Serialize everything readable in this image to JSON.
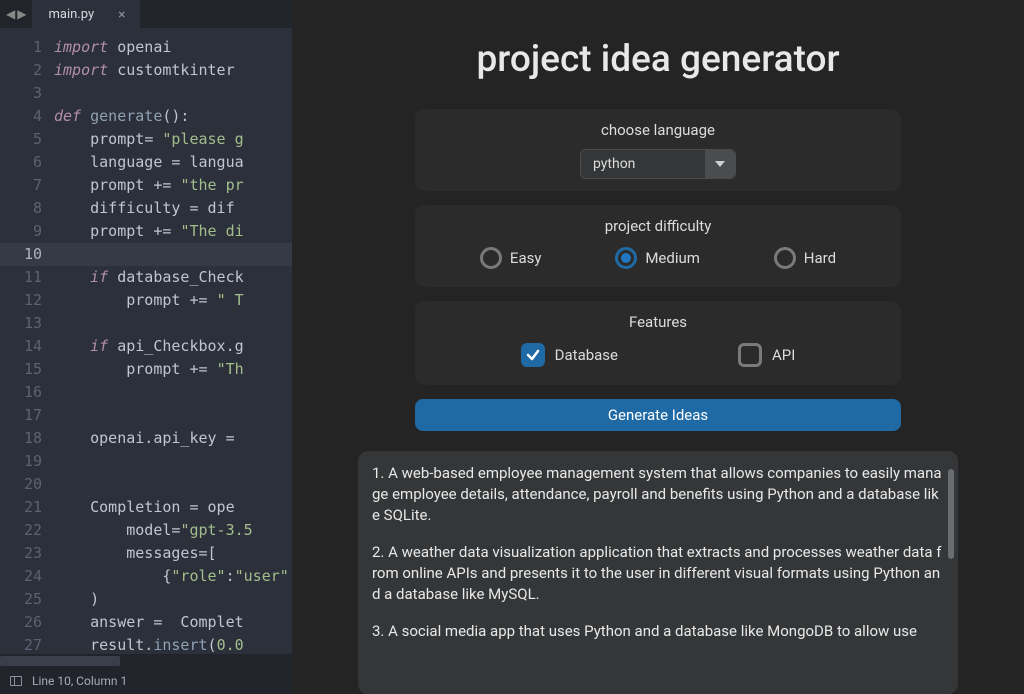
{
  "editor": {
    "tab_name": "main.py",
    "tab_close": "×",
    "nav_back": "◀",
    "nav_fwd": "▶",
    "status": "Line 10, Column 1",
    "current_line": 10,
    "lines": [
      {
        "n": 1,
        "html": "<span class='kw'>import</span> <span class='id'>openai</span>"
      },
      {
        "n": 2,
        "html": "<span class='kw'>import</span> <span class='id'>customtkinter</span>"
      },
      {
        "n": 3,
        "html": ""
      },
      {
        "n": 4,
        "html": "<span class='kw'>def</span> <span class='fn'>generate</span><span class='op'>():</span>"
      },
      {
        "n": 5,
        "html": "    prompt<span class='op'>=</span> <span class='st'>\"please g</span>"
      },
      {
        "n": 6,
        "html": "    language <span class='op'>=</span> langua"
      },
      {
        "n": 7,
        "html": "    prompt <span class='op'>+=</span> <span class='st'>\"the pr</span>"
      },
      {
        "n": 8,
        "html": "    difficulty <span class='op'>=</span> dif"
      },
      {
        "n": 9,
        "html": "    prompt <span class='op'>+=</span> <span class='st'>\"The di</span>"
      },
      {
        "n": 10,
        "html": ""
      },
      {
        "n": 11,
        "html": "    <span class='kw'>if</span> database_Check"
      },
      {
        "n": 12,
        "html": "        prompt <span class='op'>+=</span> <span class='st'>\" T</span>"
      },
      {
        "n": 13,
        "html": ""
      },
      {
        "n": 14,
        "html": "    <span class='kw'>if</span> api_Checkbox.g"
      },
      {
        "n": 15,
        "html": "        prompt <span class='op'>+=</span> <span class='st'>\"Th</span>"
      },
      {
        "n": 16,
        "html": ""
      },
      {
        "n": 17,
        "html": ""
      },
      {
        "n": 18,
        "html": "    openai.api_key <span class='op'>=</span>"
      },
      {
        "n": 19,
        "html": ""
      },
      {
        "n": 20,
        "html": ""
      },
      {
        "n": 21,
        "html": "    Completion <span class='op'>=</span> ope"
      },
      {
        "n": 22,
        "html": "        model<span class='op'>=</span><span class='st'>\"gpt-3.5</span>"
      },
      {
        "n": 23,
        "html": "        messages<span class='op'>=</span>["
      },
      {
        "n": 24,
        "html": "            {<span class='st'>\"role\"</span>:<span class='st'>\"user\"</span>"
      },
      {
        "n": 25,
        "html": "    )"
      },
      {
        "n": 26,
        "html": "    answer <span class='op'>=</span>  Complet"
      },
      {
        "n": 27,
        "html": "    result.<span class='fn'>insert</span>(<span class='st'>0.0</span>"
      }
    ]
  },
  "app": {
    "title": "project idea generator",
    "lang_label": "choose language",
    "lang_value": "python",
    "diff_label": "project difficulty",
    "diff_options": {
      "easy": "Easy",
      "medium": "Medium",
      "hard": "Hard"
    },
    "diff_selected": "medium",
    "feat_label": "Features",
    "feat_db": "Database",
    "feat_api": "API",
    "feat_db_checked": true,
    "feat_api_checked": false,
    "generate_label": "Generate Ideas",
    "results": [
      "1. A web-based employee management system that allows companies to easily manage employee details, attendance, payroll and benefits using Python and a database like SQLite.",
      "2. A weather data visualization application that extracts and processes weather data from online APIs and presents it to the user in different visual formats using Python and a database like MySQL.",
      "3. A social media app that uses Python and a database like MongoDB to allow use"
    ]
  }
}
